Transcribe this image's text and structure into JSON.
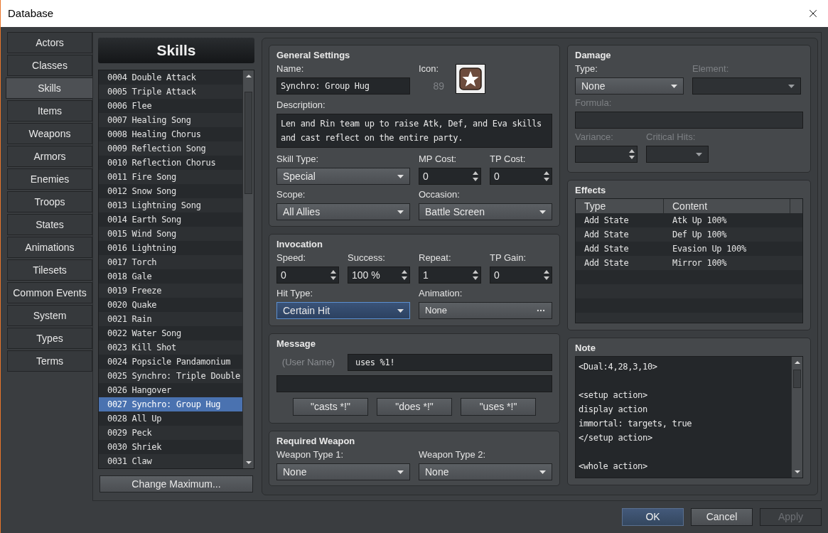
{
  "window": {
    "title": "Database"
  },
  "nav": [
    {
      "label": "Actors",
      "selected": false
    },
    {
      "label": "Classes",
      "selected": false
    },
    {
      "label": "Skills",
      "selected": true
    },
    {
      "label": "Items",
      "selected": false
    },
    {
      "label": "Weapons",
      "selected": false
    },
    {
      "label": "Armors",
      "selected": false
    },
    {
      "label": "Enemies",
      "selected": false
    },
    {
      "label": "Troops",
      "selected": false
    },
    {
      "label": "States",
      "selected": false
    },
    {
      "label": "Animations",
      "selected": false
    },
    {
      "label": "Tilesets",
      "selected": false
    },
    {
      "label": "Common Events",
      "selected": false
    },
    {
      "label": "System",
      "selected": false
    },
    {
      "label": "Types",
      "selected": false
    },
    {
      "label": "Terms",
      "selected": false
    }
  ],
  "list": {
    "title": "Skills",
    "items": [
      {
        "label": "0004 Double Attack",
        "selected": false
      },
      {
        "label": "0005 Triple Attack",
        "selected": false
      },
      {
        "label": "0006 Flee",
        "selected": false
      },
      {
        "label": "0007 Healing Song",
        "selected": false
      },
      {
        "label": "0008 Healing Chorus",
        "selected": false
      },
      {
        "label": "0009 Reflection Song",
        "selected": false
      },
      {
        "label": "0010 Reflection Chorus",
        "selected": false
      },
      {
        "label": "0011 Fire Song",
        "selected": false
      },
      {
        "label": "0012 Snow Song",
        "selected": false
      },
      {
        "label": "0013 Lightning Song",
        "selected": false
      },
      {
        "label": "0014 Earth Song",
        "selected": false
      },
      {
        "label": "0015 Wind Song",
        "selected": false
      },
      {
        "label": "0016 Lightning",
        "selected": false
      },
      {
        "label": "0017 Torch",
        "selected": false
      },
      {
        "label": "0018 Gale",
        "selected": false
      },
      {
        "label": "0019 Freeze",
        "selected": false
      },
      {
        "label": "0020 Quake",
        "selected": false
      },
      {
        "label": "0021 Rain",
        "selected": false
      },
      {
        "label": "0022 Water Song",
        "selected": false
      },
      {
        "label": "0023 Kill Shot",
        "selected": false
      },
      {
        "label": "0024 Popsicle Pandamonium",
        "selected": false
      },
      {
        "label": "0025 Synchro: Triple Double",
        "selected": false
      },
      {
        "label": "0026 Hangover",
        "selected": false
      },
      {
        "label": "0027 Synchro: Group Hug",
        "selected": true
      },
      {
        "label": "0028 All Up",
        "selected": false
      },
      {
        "label": "0029 Peck",
        "selected": false
      },
      {
        "label": "0030 Shriek",
        "selected": false
      },
      {
        "label": "0031 Claw",
        "selected": false
      }
    ],
    "button": "Change Maximum..."
  },
  "general": {
    "title": "General Settings",
    "fields": [
      {
        "label": "Name:",
        "kind": "text",
        "value": "Synchro: Group Hug"
      },
      {
        "label": "Icon:",
        "kind": "icon",
        "value": "89"
      },
      {
        "label": "Description:",
        "kind": "textarea",
        "value": "Len and Rin team up to raise Atk, Def, and Eva skills and cast reflect on the entire party."
      },
      {
        "label": "Skill Type:",
        "kind": "select",
        "value": "Special"
      },
      {
        "label": "MP Cost:",
        "kind": "spin",
        "value": "0"
      },
      {
        "label": "TP Cost:",
        "kind": "spin",
        "value": "0"
      },
      {
        "label": "Scope:",
        "kind": "select",
        "value": "All Allies"
      },
      {
        "label": "Occasion:",
        "kind": "select",
        "value": "Battle Screen"
      }
    ]
  },
  "invocation": {
    "title": "Invocation",
    "fields": [
      {
        "label": "Speed:",
        "kind": "spin",
        "value": "0",
        "focused": false
      },
      {
        "label": "Success:",
        "kind": "spin",
        "value": "100 %",
        "focused": false
      },
      {
        "label": "Repeat:",
        "kind": "spin",
        "value": "1",
        "focused": false
      },
      {
        "label": "TP Gain:",
        "kind": "spin",
        "value": "0",
        "focused": false
      },
      {
        "label": "Hit Type:",
        "kind": "select",
        "value": "Certain Hit",
        "focused": true
      },
      {
        "label": "Animation:",
        "kind": "picker",
        "value": "None",
        "focused": false
      }
    ]
  },
  "message": {
    "title": "Message",
    "user_label": "(User Name)",
    "line1": "uses %1!",
    "buttons": [
      "\"casts *!\"",
      "\"does *!\"",
      "\"uses *!\""
    ]
  },
  "weapon": {
    "title": "Required Weapon",
    "fields": [
      {
        "label": "Weapon Type 1:",
        "kind": "select",
        "value": "None"
      },
      {
        "label": "Weapon Type 2:",
        "kind": "select",
        "value": "None"
      }
    ]
  },
  "damage": {
    "title": "Damage",
    "fields": [
      {
        "label": "Type:",
        "kind": "select",
        "value": "None",
        "disabled": false
      },
      {
        "label": "Element:",
        "kind": "select",
        "disabled": true
      },
      {
        "label": "Formula:",
        "kind": "text",
        "disabled": true
      },
      {
        "label": "Variance:",
        "kind": "spin",
        "disabled": true
      },
      {
        "label": "Critical Hits:",
        "kind": "select",
        "disabled": true
      }
    ]
  },
  "effects": {
    "title": "Effects",
    "columns": [
      "Type",
      "Content"
    ],
    "rows": [
      [
        "Add State",
        "Atk Up 100%"
      ],
      [
        "Add State",
        "Def Up 100%"
      ],
      [
        "Add State",
        "Evasion Up 100%"
      ],
      [
        "Add State",
        "Mirror 100%"
      ]
    ]
  },
  "note": {
    "title": "Note",
    "text": "<Dual:4,28,3,10>\n\n<setup action>\ndisplay action\nimmortal: targets, true\n</setup action>\n\n<whole action>"
  },
  "buttons": [
    {
      "label": "OK",
      "default": true,
      "disabled": false
    },
    {
      "label": "Cancel",
      "default": false,
      "disabled": false
    },
    {
      "label": "Apply",
      "default": false,
      "disabled": true
    }
  ]
}
